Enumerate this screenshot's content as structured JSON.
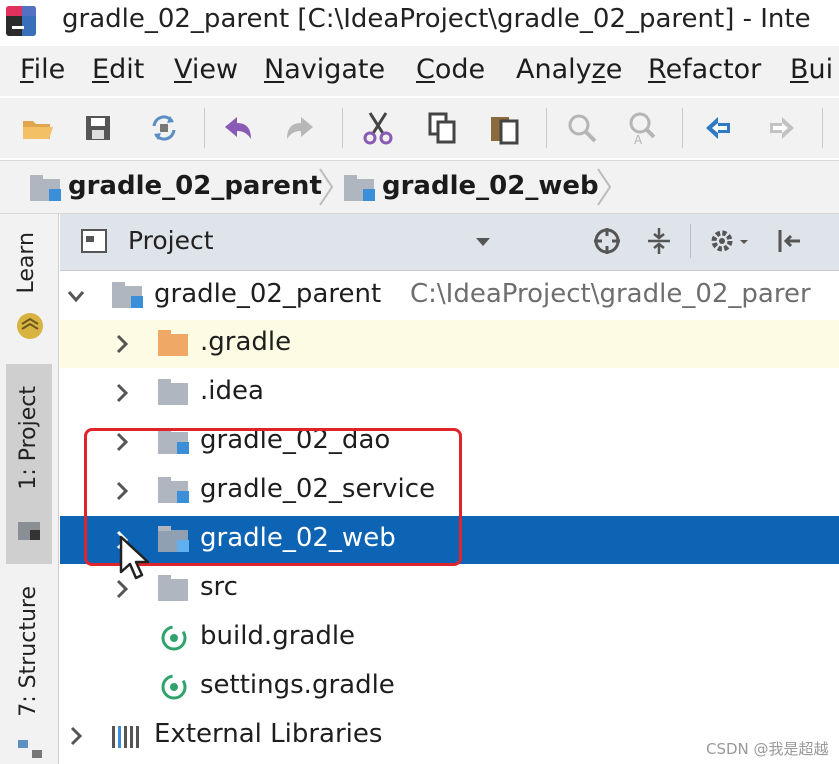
{
  "window": {
    "title": "gradle_02_parent [C:\\IdeaProject\\gradle_02_parent] - Inte"
  },
  "menu": {
    "items": [
      {
        "pre": "",
        "u": "F",
        "post": "ile"
      },
      {
        "pre": "",
        "u": "E",
        "post": "dit"
      },
      {
        "pre": "",
        "u": "V",
        "post": "iew"
      },
      {
        "pre": "",
        "u": "N",
        "post": "avigate"
      },
      {
        "pre": "",
        "u": "C",
        "post": "ode"
      },
      {
        "pre": "Analy",
        "u": "z",
        "post": "e"
      },
      {
        "pre": "",
        "u": "R",
        "post": "efactor"
      },
      {
        "pre": "",
        "u": "B",
        "post": "ui"
      }
    ]
  },
  "toolbar": {
    "icons": [
      "open-folder-icon",
      "save-icon",
      "sync-icon",
      "undo-icon",
      "redo-icon",
      "cut-icon",
      "copy-icon",
      "paste-icon",
      "find-icon",
      "replace-icon",
      "back-icon",
      "forward-icon"
    ]
  },
  "navbar": {
    "crumbs": [
      "gradle_02_parent",
      "gradle_02_web"
    ]
  },
  "toolstrip": {
    "learn": "Learn",
    "project": "1: Project",
    "structure": "7: Structure"
  },
  "panel": {
    "title": "Project"
  },
  "tree": {
    "root_name": "gradle_02_parent",
    "root_path": "C:\\IdeaProject\\gradle_02_parer",
    "items": {
      "gradle": ".gradle",
      "idea": ".idea",
      "dao": "gradle_02_dao",
      "service": "gradle_02_service",
      "web": "gradle_02_web",
      "src": "src",
      "build": "build.gradle",
      "settings": "settings.gradle",
      "external": "External Libraries"
    }
  },
  "colors": {
    "selection": "#0e64b4",
    "annotation": "#e0242b",
    "highlight_row": "#fefbe4"
  },
  "watermark": "CSDN @我是超越"
}
